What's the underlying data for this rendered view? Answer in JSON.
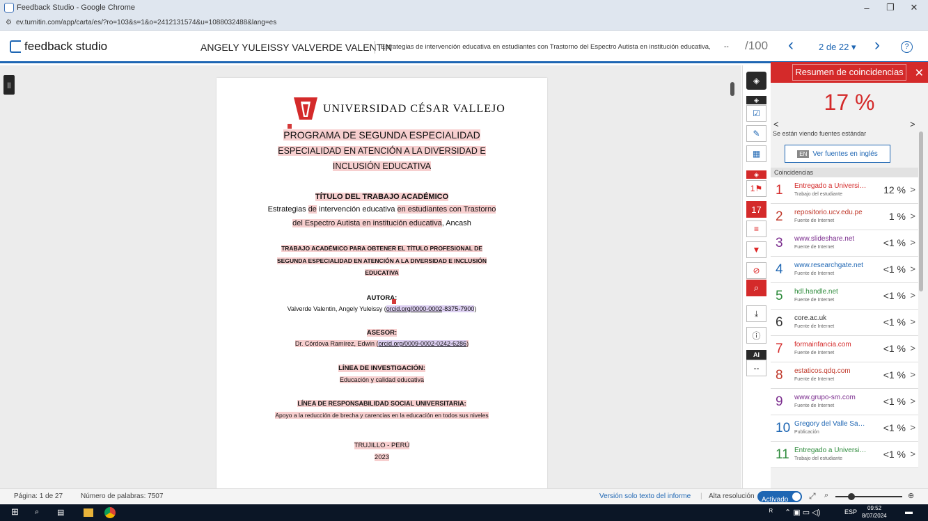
{
  "browser": {
    "window_title": "Feedback Studio - Google Chrome",
    "url": "ev.turnitin.com/app/carta/es/?ro=103&s=1&o=2412131574&u=1088032488&lang=es",
    "minimize": "–",
    "maximize": "❐",
    "close": "✕"
  },
  "header": {
    "logo_text": "feedback studio",
    "author": "ANGELY YULEISSY VALVERDE VALENTIN",
    "doc_title": "Estrategias de intervención educativa en estudiantes con Trastorno del Espectro Autista en institución educativa, Anc...",
    "score": "--",
    "score_out_of": "/100",
    "prev": "‹",
    "next": "›",
    "pager": "2 de 22 ▾",
    "help": "?"
  },
  "document": {
    "university": "UNIVERSIDAD CÉSAR VALLEJO",
    "program": "PROGRAMA DE SEGUNDA ESPECIALIDAD",
    "specialty_1": "ESPECIALIDAD EN ATENCIÓN A LA DIVERSIDAD E",
    "specialty_2": "INCLUSIÓN EDUCATIVA",
    "title_heading": "TÍTULO DEL TRABAJO ACADÉMICO",
    "title_line1_a": "Estrategias ",
    "title_line1_b": "de",
    "title_line1_c": " intervención educativa ",
    "title_line1_d": "en estudiantes con Trastorno",
    "title_line2_a": "del Espectro Autista en institución educativa",
    "title_line2_b": ", Ancash",
    "obtain_1": "TRABAJO ACADÉMICO PARA OBTENER EL TÍTULO PROFESIONAL DE",
    "obtain_2": "SEGUNDA ESPECIALIDAD EN ATENCIÓN A LA DIVERSIDAD E INCLUSIÓN",
    "obtain_3": "EDUCATIVA",
    "author_heading": "AUTORA:",
    "author_line_a": "Valverde Valentin, Angely Yuleissy (",
    "author_orcid_a": "orcid.org/0000-0002",
    "author_orcid_b": "-8375-7900",
    "author_line_b": ")",
    "advisor_heading": "ASESOR:",
    "advisor_line_a": "Dr. Córdova Ramírez, Edwin (",
    "advisor_orcid": "orcid.org/0009-0002-0242-6286",
    "advisor_line_b": ")",
    "research_heading": "LÍNEA DE INVESTIGACIÓN:",
    "research_line": "Educación y calidad educativa",
    "social_heading": "LÍNEA DE RESPONSABILIDAD SOCIAL UNIVERSITARIA:",
    "social_line": "Apoyo a la reducción de brecha y carencias en la educación en todos sus niveles",
    "city": "TRUJILLO - PERÚ",
    "year": "2023",
    "marker_1": "1",
    "marker_2": "5"
  },
  "toolbar": {
    "layers": "◈",
    "layers2": "◈",
    "check": "☑",
    "edit": "✎",
    "grid": "▦",
    "layers3": "◈",
    "flag": "1⚑",
    "count": "17",
    "sort": "≡",
    "filter": "▼",
    "exclude": "⊘",
    "search": "⌕",
    "download": "⤓",
    "info": "ⓘ",
    "ai": "AI",
    "ai_value": "--"
  },
  "panel": {
    "title": "Resumen de coincidencias",
    "close": "✕",
    "percent": "17 %",
    "nav_left": "<",
    "nav_right": ">",
    "note": "Se están viendo fuentes estándar",
    "en_badge": "EN",
    "english_button": "Ver fuentes en inglés",
    "matches_label": "Coincidencias",
    "matches": [
      {
        "num": "1",
        "source": "Entregado a Universida...",
        "type": "Trabajo del estudiante",
        "pct": "12 %",
        "color": "#d42a2a"
      },
      {
        "num": "2",
        "source": "repositorio.ucv.edu.pe",
        "type": "Fuente de Internet",
        "pct": "1 %",
        "color": "#c0392b"
      },
      {
        "num": "3",
        "source": "www.slideshare.net",
        "type": "Fuente de Internet",
        "pct": "<1 %",
        "color": "#7b2d8e"
      },
      {
        "num": "4",
        "source": "www.researchgate.net",
        "type": "Fuente de Internet",
        "pct": "<1 %",
        "color": "#1e66b3"
      },
      {
        "num": "5",
        "source": "hdl.handle.net",
        "type": "Fuente de Internet",
        "pct": "<1 %",
        "color": "#2e8b3c"
      },
      {
        "num": "6",
        "source": "core.ac.uk",
        "type": "Fuente de Internet",
        "pct": "<1 %",
        "color": "#333333"
      },
      {
        "num": "7",
        "source": "formainfancia.com",
        "type": "Fuente de Internet",
        "pct": "<1 %",
        "color": "#d42a2a"
      },
      {
        "num": "8",
        "source": "estaticos.qdq.com",
        "type": "Fuente de Internet",
        "pct": "<1 %",
        "color": "#c0392b"
      },
      {
        "num": "9",
        "source": "www.grupo-sm.com",
        "type": "Fuente de Internet",
        "pct": "<1 %",
        "color": "#7b2d8e"
      },
      {
        "num": "10",
        "source": "Gregory del Valle Sand...",
        "type": "Publicación",
        "pct": "<1 %",
        "color": "#1e66b3"
      },
      {
        "num": "11",
        "source": "Entregado a Universida...",
        "type": "Trabajo del estudiante",
        "pct": "<1 %",
        "color": "#2e8b3c"
      }
    ]
  },
  "status": {
    "page": "Página: 1 de 27",
    "words": "Número de palabras: 7507",
    "text_only": "Versión solo texto del informe",
    "high_res": "Alta resolución",
    "toggle": "Activado"
  },
  "taskbar": {
    "start": "⊞",
    "search": "⌕",
    "lang": "ESP",
    "time": "09:52",
    "date": "8/07/2024"
  }
}
